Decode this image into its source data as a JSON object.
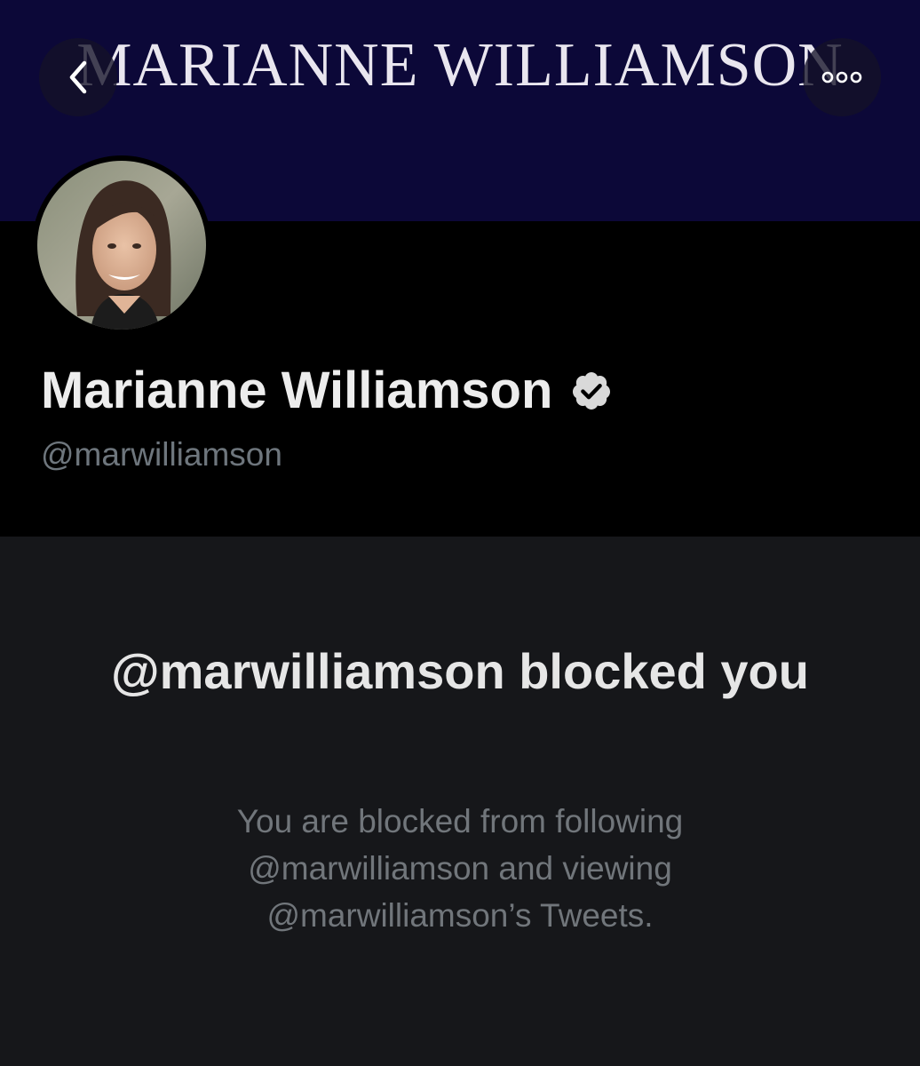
{
  "banner": {
    "title": "MARIANNE WILLIAMSON",
    "background_color": "#0c0838"
  },
  "nav": {
    "back_icon": "chevron-left-icon",
    "more_icon": "more-horizontal-icon"
  },
  "profile": {
    "display_name": "Marianne Williamson",
    "handle": "@marwilliamson",
    "verified_icon": "verified-badge-icon"
  },
  "blocked": {
    "title": "@marwilliamson blocked you",
    "line1": "You are blocked from following",
    "line2": "@marwilliamson and viewing",
    "line3": "@marwilliamson’s Tweets."
  },
  "colors": {
    "banner": "#0c0838",
    "profile_bg": "#000000",
    "panel_bg": "#16171a",
    "primary_text": "#ededed",
    "secondary_text": "#71767b"
  }
}
